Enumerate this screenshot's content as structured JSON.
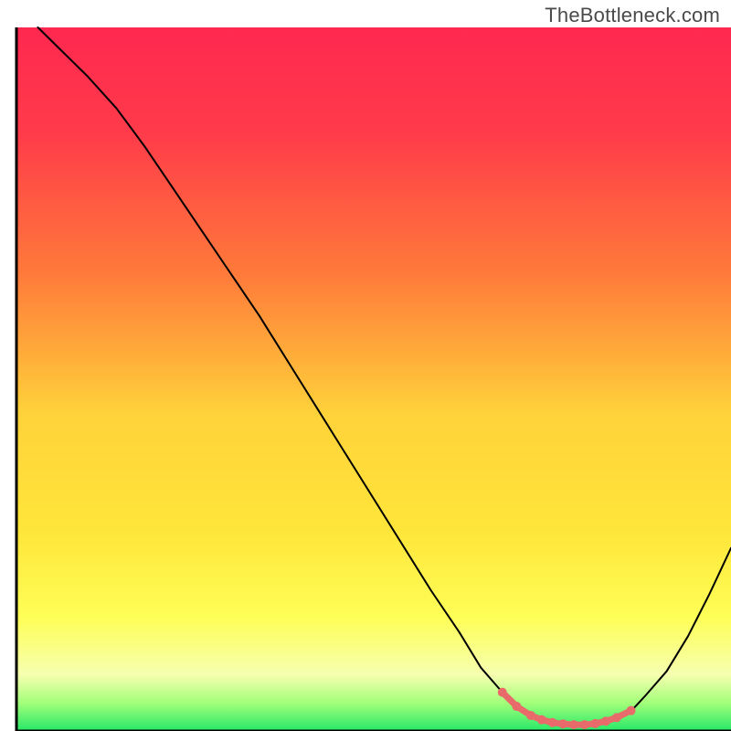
{
  "watermark": "TheBottleneck.com",
  "chart_data": {
    "type": "line",
    "title": "",
    "xlabel": "",
    "ylabel": "",
    "xlim": [
      0,
      100
    ],
    "ylim": [
      0,
      100
    ],
    "gradient_stops": [
      {
        "offset": 0,
        "color": "#ff2850"
      },
      {
        "offset": 15,
        "color": "#ff3b4a"
      },
      {
        "offset": 35,
        "color": "#ff7a3a"
      },
      {
        "offset": 55,
        "color": "#ffd23a"
      },
      {
        "offset": 72,
        "color": "#ffe63a"
      },
      {
        "offset": 84,
        "color": "#feff58"
      },
      {
        "offset": 92,
        "color": "#f6ffb0"
      },
      {
        "offset": 96,
        "color": "#a3ff7a"
      },
      {
        "offset": 100,
        "color": "#25e868"
      }
    ],
    "series": [
      {
        "name": "main-curve",
        "color": "#000000",
        "x": [
          3,
          6,
          10,
          14,
          18,
          22,
          26,
          30,
          34,
          38,
          42,
          46,
          50,
          54,
          58,
          62,
          65,
          68,
          70.5,
          72.5,
          74,
          76,
          78,
          80,
          82,
          84,
          86,
          88,
          91,
          94,
          97,
          100
        ],
        "y": [
          100,
          97,
          93,
          88.5,
          83,
          77,
          71,
          65,
          59,
          52.5,
          46,
          39.5,
          33,
          26.5,
          20,
          14,
          9,
          5.5,
          3.2,
          2.0,
          1.4,
          1.0,
          0.85,
          0.85,
          1.1,
          1.7,
          2.8,
          5.0,
          8.5,
          13.5,
          19.5,
          26
        ]
      },
      {
        "name": "highlight-segment",
        "color": "#e86a6a",
        "stroke_width": 7,
        "x": [
          68,
          70,
          72,
          73.5,
          75,
          76.5,
          78,
          79.5,
          81,
          82.5,
          84,
          86
        ],
        "y": [
          5.5,
          3.5,
          2.2,
          1.6,
          1.2,
          1.0,
          0.9,
          0.9,
          1.05,
          1.4,
          1.9,
          2.9
        ]
      }
    ],
    "highlight_markers": {
      "color": "#e86a6a",
      "radius": 5,
      "x": [
        68,
        70,
        72,
        73.5,
        75,
        76.5,
        78,
        79.5,
        81,
        82.5,
        84,
        86
      ],
      "y": [
        5.5,
        3.5,
        2.2,
        1.6,
        1.2,
        1.0,
        0.9,
        0.9,
        1.05,
        1.4,
        1.9,
        2.9
      ]
    }
  }
}
